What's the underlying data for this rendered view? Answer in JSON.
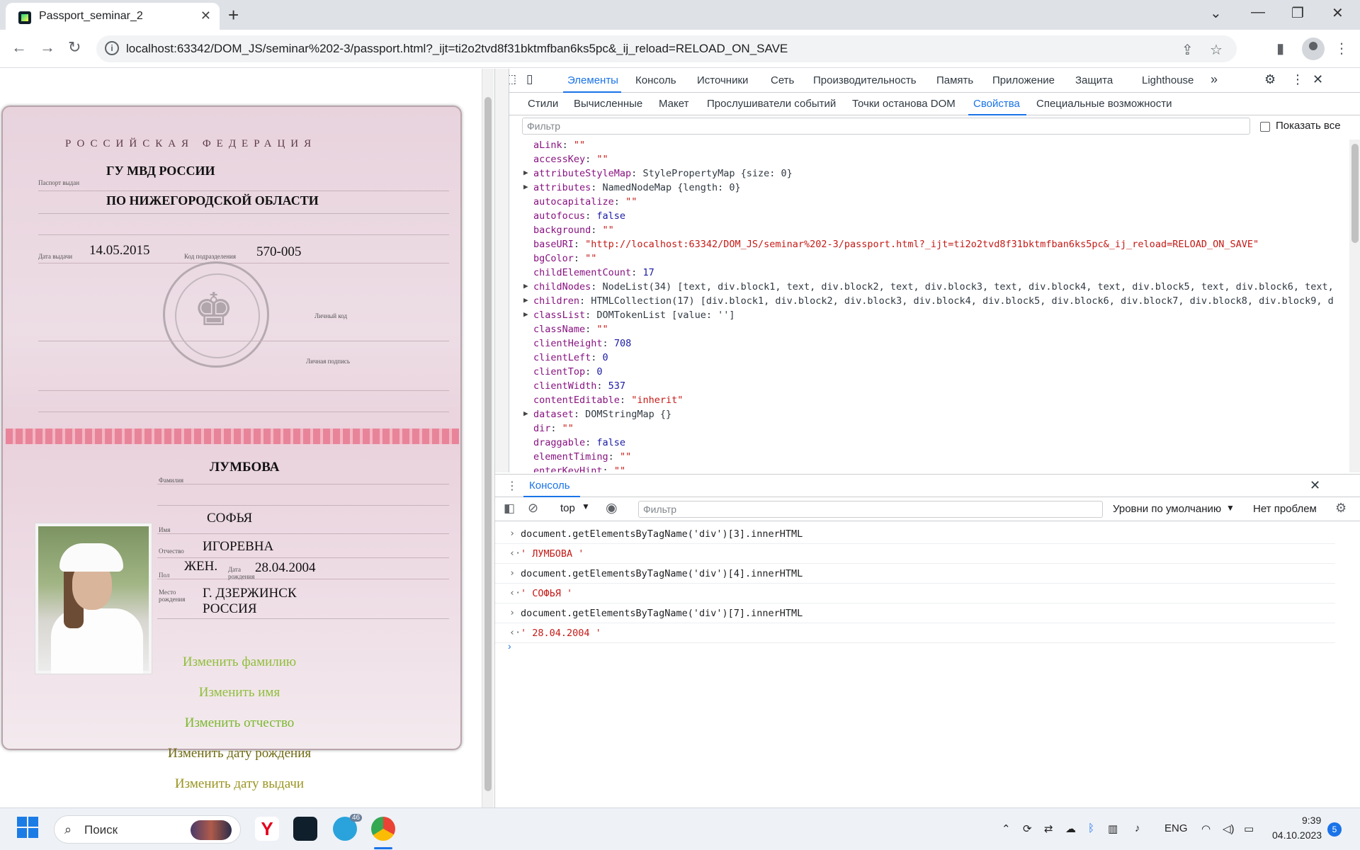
{
  "browser": {
    "tab_title": "Passport_seminar_2",
    "url": "localhost:63342/DOM_JS/seminar%202-3/passport.html?_ijt=ti2o2tvd8f31bktmfban6ks5pc&_ij_reload=RELOAD_ON_SAVE"
  },
  "passport": {
    "country": "РОССИЙСКАЯ ФЕДЕРАЦИЯ",
    "issuer_line1": "ГУ МВД РОССИИ",
    "issuer_line2": "ПО НИЖЕГОРОДСКОЙ ОБЛАСТИ",
    "label_issued_by": "Паспорт выдан",
    "label_issue_date": "Дата выдачи",
    "issue_date": "14.05.2015",
    "label_dept_code": "Код подразделения",
    "dept_code": "570-005",
    "label_personal_code": "Личный код",
    "label_signature": "Личная подпись",
    "surname": "ЛУМБОВА",
    "label_surname": "Фамилия",
    "name": "СОФЬЯ",
    "label_name": "Имя",
    "patronymic": "ИГОРЕВНА",
    "label_patronymic": "Отчество",
    "sex": "ЖЕН.",
    "label_sex": "Пол",
    "label_birth_date": "Дата рождения",
    "birth_date": "28.04.2004",
    "label_birth_place": "Место рождения",
    "birth_place_line1": "Г. ДЗЕРЖИНСК",
    "birth_place_line2": "РОССИЯ"
  },
  "links": {
    "change_surname": "Изменить фамилию",
    "change_name": "Изменить имя",
    "change_patronymic": "Изменить отчество",
    "change_birth_date": "Изменить дату рождения",
    "change_issue_date": "Изменить дату выдачи"
  },
  "devtools": {
    "tabs": [
      "Элементы",
      "Консоль",
      "Источники",
      "Сеть",
      "Производительность",
      "Память",
      "Приложение",
      "Защита",
      "Lighthouse"
    ],
    "more_tabs": "»",
    "subtabs": [
      "Стили",
      "Вычисленные",
      "Макет",
      "Прослушиватели событий",
      "Точки останова DOM",
      "Свойства",
      "Специальные возможности"
    ],
    "filter_placeholder": "Фильтр",
    "show_all": "Показать все",
    "properties": [
      {
        "key": "aLink",
        "val": "\"\"",
        "type": "str",
        "exp": false
      },
      {
        "key": "accessKey",
        "val": "\"\"",
        "type": "str",
        "exp": false
      },
      {
        "key": "attributeStyleMap",
        "val": "StylePropertyMap {size: 0}",
        "type": "obj",
        "exp": true
      },
      {
        "key": "attributes",
        "val": "NamedNodeMap {length: 0}",
        "type": "obj",
        "exp": true
      },
      {
        "key": "autocapitalize",
        "val": "\"\"",
        "type": "str",
        "exp": false
      },
      {
        "key": "autofocus",
        "val": "false",
        "type": "num",
        "exp": false
      },
      {
        "key": "background",
        "val": "\"\"",
        "type": "str",
        "exp": false
      },
      {
        "key": "baseURI",
        "val": "\"http://localhost:63342/DOM_JS/seminar%202-3/passport.html?_ijt=ti2o2tvd8f31bktmfban6ks5pc&_ij_reload=RELOAD_ON_SAVE\"",
        "type": "str",
        "exp": false
      },
      {
        "key": "bgColor",
        "val": "\"\"",
        "type": "str",
        "exp": false
      },
      {
        "key": "childElementCount",
        "val": "17",
        "type": "num",
        "exp": false
      },
      {
        "key": "childNodes",
        "val": "NodeList(34) [text, div.block1, text, div.block2, text, div.block3, text, div.block4, text, div.block5, text, div.block6, text,",
        "type": "obj",
        "exp": true
      },
      {
        "key": "children",
        "val": "HTMLCollection(17) [div.block1, div.block2, div.block3, div.block4, div.block5, div.block6, div.block7, div.block8, div.block9, d",
        "type": "obj",
        "exp": true
      },
      {
        "key": "classList",
        "val": "DOMTokenList [value: '']",
        "type": "obj",
        "exp": true
      },
      {
        "key": "className",
        "val": "\"\"",
        "type": "str",
        "exp": false
      },
      {
        "key": "clientHeight",
        "val": "708",
        "type": "num",
        "exp": false
      },
      {
        "key": "clientLeft",
        "val": "0",
        "type": "num",
        "exp": false
      },
      {
        "key": "clientTop",
        "val": "0",
        "type": "num",
        "exp": false
      },
      {
        "key": "clientWidth",
        "val": "537",
        "type": "num",
        "exp": false
      },
      {
        "key": "contentEditable",
        "val": "\"inherit\"",
        "type": "str",
        "exp": false
      },
      {
        "key": "dataset",
        "val": "DOMStringMap {}",
        "type": "obj",
        "exp": true
      },
      {
        "key": "dir",
        "val": "\"\"",
        "type": "str",
        "exp": false
      },
      {
        "key": "draggable",
        "val": "false",
        "type": "num",
        "exp": false
      },
      {
        "key": "elementTiming",
        "val": "\"\"",
        "type": "str",
        "exp": false
      },
      {
        "key": "enterKeyHint",
        "val": "\"\"",
        "type": "str",
        "exp": false
      }
    ],
    "drawer_tab": "Консоль",
    "console_context": "top",
    "console_filter_placeholder": "Фильтр",
    "levels": "Уровни по умолчанию",
    "issues": "Нет проблем",
    "console_rows": [
      {
        "kind": "in",
        "text": "document.getElementsByTagName('div')[3].innerHTML"
      },
      {
        "kind": "out",
        "text": "' ЛУМБОВА '"
      },
      {
        "kind": "in",
        "text": "document.getElementsByTagName('div')[4].innerHTML"
      },
      {
        "kind": "out",
        "text": "' СОФЬЯ '"
      },
      {
        "kind": "in",
        "text": "document.getElementsByTagName('div')[7].innerHTML"
      },
      {
        "kind": "out",
        "text": "' 28.04.2004 '"
      }
    ]
  },
  "taskbar": {
    "search": "Поиск",
    "telegram_badge": "46",
    "lang": "ENG",
    "time": "9:39",
    "date": "04.10.2023",
    "notifications": "5"
  },
  "colors": {
    "accent": "#1a73e8",
    "link_green": "#8fbf3a",
    "link_olive": "#7f7a14"
  }
}
